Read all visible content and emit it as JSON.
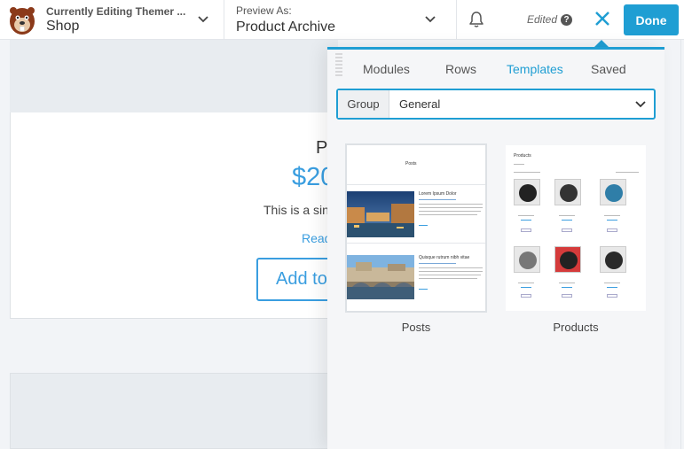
{
  "topbar": {
    "editing_caption": "Currently Editing Themer ...",
    "editing_value": "Shop",
    "preview_caption": "Preview As:",
    "preview_value": "Product Archive",
    "status": "Edited",
    "help": "?",
    "done_label": "Done"
  },
  "page": {
    "product_title": "P",
    "product_price": "$20",
    "product_desc": "This is a sin",
    "read_more": "Read",
    "add_to_cart": "Add to"
  },
  "panel": {
    "tabs": [
      {
        "label": "Modules"
      },
      {
        "label": "Rows"
      },
      {
        "label": "Templates",
        "active": true
      },
      {
        "label": "Saved"
      }
    ],
    "group_label": "Group",
    "group_value": "General",
    "templates": [
      {
        "label": "Posts"
      },
      {
        "label": "Products"
      }
    ],
    "posts_preview": {
      "heading": "Posts",
      "post1_title": "Lorem Ipsum Dolor",
      "post2_title": "Quisque rutrum nibh vitae"
    },
    "products_preview": {
      "heading": "Products"
    }
  },
  "colors": {
    "accent": "#1f9ed3",
    "link": "#3a9ee0"
  }
}
